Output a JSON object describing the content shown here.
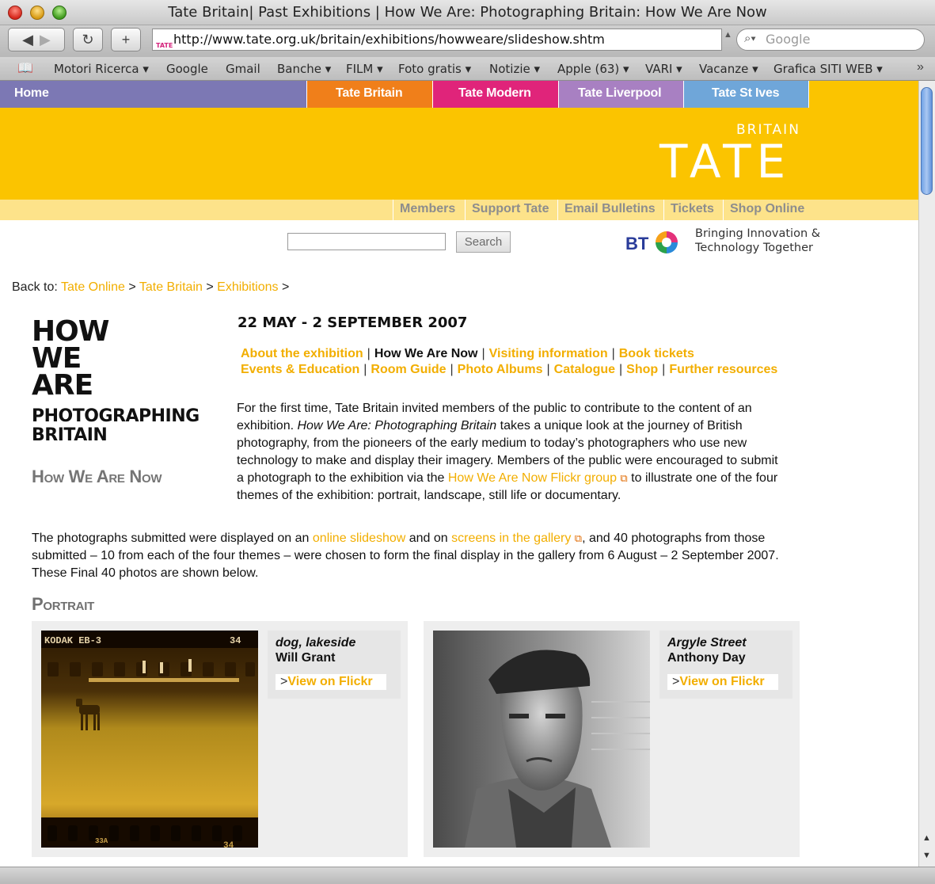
{
  "browser": {
    "window_title": "Tate Britain| Past Exhibitions | How We Are: Photographing Britain: How We Are Now",
    "back_icon": "back-arrow-icon",
    "forward_icon": "forward-arrow-icon",
    "reload_icon": "reload-icon",
    "add_icon": "add-bookmark-icon",
    "url": "http://www.tate.org.uk/britain/exhibitions/howweare/slideshow.shtm",
    "favicon_text": "TATE",
    "search_placeholder": "Google",
    "bookmarks": [
      "Motori Ricerca ▾",
      "Google",
      "Gmail",
      "Banche ▾",
      "FILM ▾",
      "Foto gratis ▾",
      "Notizie ▾",
      "Apple (63) ▾",
      "VARI ▾",
      "Vacanze ▾",
      "Grafica SITI WEB ▾"
    ],
    "bookmarks_more": "»"
  },
  "site": {
    "nav": [
      {
        "label": "Home",
        "color": "#7c78b4"
      },
      {
        "label": "Tate Britain",
        "color": "#f07f1a"
      },
      {
        "label": "Tate Modern",
        "color": "#e0247a"
      },
      {
        "label": "Tate Liverpool",
        "color": "#a880c2"
      },
      {
        "label": "Tate St Ives",
        "color": "#6fa6d9"
      }
    ],
    "banner_color": "#fbc400",
    "logo_sub": "BRITAIN",
    "logo": "TATE",
    "subnav": [
      "Members",
      "Support Tate",
      "Email Bulletins",
      "Tickets",
      "Shop Online"
    ],
    "search_button": "Search",
    "sponsor_logo": "BT",
    "sponsor_line1": "Bringing Innovation &",
    "sponsor_line2": "Technology Together"
  },
  "breadcrumb": {
    "prefix": "Back to:",
    "items": [
      "Tate Online",
      "Tate Britain",
      "Exhibitions"
    ],
    "separator": ">"
  },
  "exhibition": {
    "logo_line1": "HOW",
    "logo_line2": "WE",
    "logo_line3": "ARE",
    "logo_line4": "PHOTOGRAPHING",
    "logo_line5": "BRITAIN",
    "section_title": "How We Are Now",
    "dates": "22 MAY - 2 SEPTEMBER 2007",
    "nav_row1": [
      "About the exhibition",
      "How We Are Now",
      "Visiting information",
      "Book tickets"
    ],
    "nav_row2": [
      "Events & Education",
      "Room Guide",
      "Photo Albums",
      "Catalogue",
      "Shop",
      "Further resources"
    ],
    "current_nav": "How We Are Now",
    "intro": {
      "t1": "For the first time, Tate Britain invited members of the public to contribute to the content of an exhibition. ",
      "t2": "How We Are: Photographing Britain",
      "t3": " takes a unique look at the journey of British photography, from the pioneers of the early medium to today’s photographers who use new technology to make and display their imagery. Members of the public were encouraged to submit a photograph to the exhibition via the ",
      "link": "How We Are Now Flickr group",
      "t4": " to illustrate one of the four themes of the exhibition: portrait, landscape, still life or documentary."
    },
    "second": {
      "t1": "The photographs submitted were displayed on an ",
      "link1": "online slideshow",
      "t2": " and on ",
      "link2": "screens in the gallery",
      "t3": ", and 40 photographs from those submitted – 10 from each of the four themes – were chosen to form the final display in the gallery from 6 August – 2 September 2007. These Final 40 photos are shown below."
    },
    "portrait_title": "Portrait",
    "photos": [
      {
        "title": "dog, lakeside",
        "author": "Will Grant",
        "button": "View on Flickr",
        "film_top_left": "KODAK  EB-3",
        "film_top_right": "34",
        "film_bottom_left": "33A",
        "film_bottom_right": "34"
      },
      {
        "title": "Argyle Street",
        "author": "Anthony Day",
        "button": "View on Flickr"
      }
    ]
  }
}
